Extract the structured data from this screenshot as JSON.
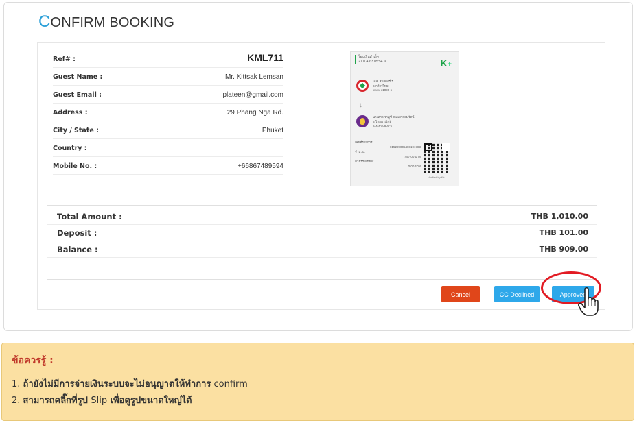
{
  "page": {
    "title_first": "C",
    "title_rest": "ONFIRM BOOKING"
  },
  "booking": {
    "ref_label": "Ref# :",
    "ref_value": "KML711",
    "guest_name_label": "Guest Name :",
    "guest_name_value": "Mr. Kittsak Lemsan",
    "guest_email_label": "Guest Email :",
    "guest_email_value": "plateen@gmail.com",
    "address_label": "Address :",
    "address_value": "29 Phang Nga Rd.",
    "city_label": "City / State :",
    "city_value": "Phuket",
    "country_label": "Country :",
    "country_value": "",
    "mobile_label": "Mobile No. :",
    "mobile_value": "+66867489594"
  },
  "slip": {
    "header_line1": "โอนเงินสำเร็จ",
    "header_line2": "21 0.A-63 05:54 น.",
    "brand": "K",
    "brand_plus": "+",
    "sender_line1": "น.ส. ส้มสตอรี่ ร",
    "sender_line2": "ธ.กสิกรไทย",
    "sender_line3": "xxx-x-x1090-x",
    "receiver_line1": "นางสาว วาฎุชี ตพพยาคุยมวัตน์",
    "receiver_line2": "ธ.ไทยพาณิชย์",
    "receiver_line3": "xxx-x-x0800-x",
    "ref_label": "เลขที่รายการ:",
    "ref_value": "015289005408191783",
    "amount_label": "จำนวน:",
    "amount_value": "457.00 บาท",
    "fee_label": "ค่าธรรมเนียม:",
    "fee_value": "0.00 บาท",
    "verified": "Verified by K+",
    "icons": [
      "kbank-logo-icon",
      "arrow-down-icon",
      "scb-logo-icon",
      "qr-code-icon"
    ]
  },
  "totals": {
    "total_label": "Total Amount :",
    "total_value": "THB 1,010.00",
    "deposit_label": "Deposit :",
    "deposit_value": "THB 101.00",
    "balance_label": "Balance :",
    "balance_value": "THB 909.00"
  },
  "actions": {
    "cancel": "Cancel",
    "declined": "CC Declined",
    "approved": "Approved"
  },
  "note": {
    "title": "ข้อควรรู้ :",
    "item1_num": "1. ",
    "item1_text": "ถ้ายังไม่มีการจ่ายเงินระบบจะไม่อนุญาตให้ทำการ",
    "item1_word": " confirm",
    "item2_num": "2. ",
    "item2_text_a": "สามารถคลิ๊กที่รูป ",
    "item2_word": "Slip",
    "item2_text_b": " เพื่อดูรูปขนาดใหญ่ได้"
  },
  "colors": {
    "accent": "#2a9fd8",
    "cancel": "#e0461a",
    "button": "#2ea8ea",
    "highlight": "#e21b23",
    "note_bg": "#fbe0a2",
    "note_title": "#c0392b"
  },
  "icons": {
    "highlight": "red-circle-highlight",
    "cursor": "hand-pointer-icon"
  }
}
